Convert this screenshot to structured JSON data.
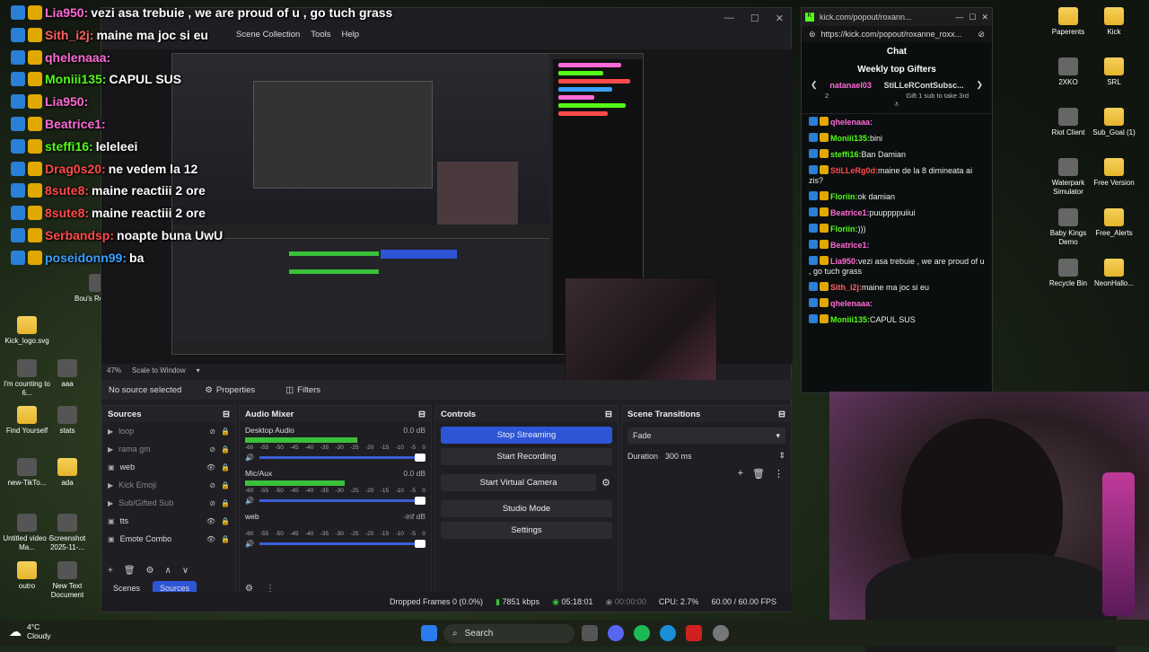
{
  "desktop": {
    "left_icons": [
      {
        "label": "Bou's Revenge"
      },
      {
        "label": "Kick_logo.svg"
      },
      {
        "label": "I'm counting to 6..."
      },
      {
        "label": "aaa"
      },
      {
        "label": "Find Yourself"
      },
      {
        "label": "stats"
      },
      {
        "label": "new-TikTo..."
      },
      {
        "label": "ada"
      },
      {
        "label": "Untitled video - Ma..."
      },
      {
        "label": "Screenshot 2025-11-..."
      },
      {
        "label": "outro"
      },
      {
        "label": "New Text Document"
      }
    ],
    "right_icons": [
      {
        "label": "Paperents"
      },
      {
        "label": "Kick"
      },
      {
        "label": "2XKO"
      },
      {
        "label": "SRL"
      },
      {
        "label": "Riot Client"
      },
      {
        "label": "Sub_Goal (1)"
      },
      {
        "label": "Waterpark Simulator"
      },
      {
        "label": "Free Version"
      },
      {
        "label": "Baby Kings Demo"
      },
      {
        "label": "Free_Alerts"
      },
      {
        "label": "Recycle Bin"
      },
      {
        "label": "NeonHallo..."
      }
    ]
  },
  "overlay_chat": [
    {
      "user": "Lia950:",
      "text": "vezi asa trebuie , we are proud of u , go tuch grass",
      "color": "#ff6bd6"
    },
    {
      "user": "Sith_i2j:",
      "text": "maine ma joc si eu",
      "color": "#ff6060"
    },
    {
      "user": "qhelenaaa:",
      "text": "",
      "color": "#ff6bd6"
    },
    {
      "user": "Moniii135:",
      "text": "CAPUL SUS",
      "color": "#53fc18"
    },
    {
      "user": "Lia950:",
      "text": "",
      "color": "#ff6bd6"
    },
    {
      "user": "Beatrice1:",
      "text": "",
      "color": "#ff6bd6"
    },
    {
      "user": "steffi16:",
      "text": "leleleei",
      "color": "#53fc18"
    },
    {
      "user": "Drag0s20:",
      "text": "ne vedem la 12",
      "color": "#ff4a4a"
    },
    {
      "user": "8sute8:",
      "text": "maine reactiii 2 ore",
      "color": "#ff4a4a"
    },
    {
      "user": "8sute8:",
      "text": "maine reactiii 2 ore",
      "color": "#ff4a4a"
    },
    {
      "user": "Serbandsp:",
      "text": "noapte buna UwU",
      "color": "#ff4a4a"
    },
    {
      "user": "poseidonn99:",
      "text": "ba",
      "color": "#3aa0ff"
    }
  ],
  "obs": {
    "menu": [
      "Scene Collection",
      "Tools",
      "Help"
    ],
    "zoom": "47%",
    "scale_mode": "Scale to Window",
    "no_source": "No source selected",
    "properties_label": "Properties",
    "filters_label": "Filters",
    "sources_title": "Sources",
    "sources": [
      {
        "name": "loop",
        "visible": false
      },
      {
        "name": "rama gm",
        "visible": false
      },
      {
        "name": "web",
        "visible": true
      },
      {
        "name": "Kick Emoji",
        "visible": false
      },
      {
        "name": "Sub/Gifted Sub",
        "visible": false
      },
      {
        "name": "tts",
        "visible": true
      },
      {
        "name": "Emote Combo",
        "visible": true
      }
    ],
    "scenes_tab": "Scenes",
    "sources_tab": "Sources",
    "mixer_title": "Audio Mixer",
    "mixer": [
      {
        "name": "Desktop Audio",
        "db": "0.0 dB",
        "level": 0.62
      },
      {
        "name": "Mic/Aux",
        "db": "0.0 dB",
        "level": 0.55
      },
      {
        "name": "web",
        "db": "-inf dB",
        "level": 0
      }
    ],
    "meter_ticks": [
      "-60",
      "-55",
      "-50",
      "-45",
      "-40",
      "-35",
      "-30",
      "-25",
      "-20",
      "-15",
      "-10",
      "-5",
      "0"
    ],
    "controls_title": "Controls",
    "controls": [
      "Stop Streaming",
      "Start Recording",
      "Start Virtual Camera",
      "Studio Mode",
      "Settings"
    ],
    "transitions_title": "Scene Transitions",
    "transition": "Fade",
    "duration_label": "Duration",
    "duration_value": "300 ms",
    "status": {
      "dropped": "Dropped Frames 0 (0.0%)",
      "kbps": "7851 kbps",
      "live_time": "05:18:01",
      "rec_time": "00:00:00",
      "cpu": "CPU: 2.7%",
      "fps": "60.00 / 60.00 FPS"
    }
  },
  "kick": {
    "tab": "kick.com/popout/roxann...",
    "url": "https://kick.com/popout/roxanne_roxx...",
    "chat_title": "Chat",
    "gifters_title": "Weekly top Gifters",
    "gifters": [
      {
        "name": "natanael03",
        "count": "2"
      },
      {
        "name": "StiLLeRContSubsc...",
        "note": "Gift 1 sub to take 3rd"
      }
    ],
    "messages": [
      {
        "user": "qhelenaaa:",
        "text": "",
        "color": "#ff6bd6"
      },
      {
        "user": "Moniii135:",
        "text": "bini",
        "color": "#53fc18"
      },
      {
        "user": "steffi16:",
        "text": "Ban Damian",
        "color": "#53fc18"
      },
      {
        "user": "StiLLeRg0d:",
        "text": "maine de la 8 dimineata ai zis?",
        "color": "#ff4a4a"
      },
      {
        "user": "Floriin:",
        "text": "ok damian",
        "color": "#53fc18"
      },
      {
        "user": "Beatrice1:",
        "text": "puuppppuiiui",
        "color": "#ff6bd6"
      },
      {
        "user": "Floriin:",
        "text": ")))",
        "color": "#53fc18"
      },
      {
        "user": "Beatrice1:",
        "text": "",
        "color": "#ff6bd6"
      },
      {
        "user": "Lia950:",
        "text": "vezi asa trebuie , we are proud of u , go tuch grass",
        "color": "#ff6bd6"
      },
      {
        "user": "Sith_i2j:",
        "text": "maine ma joc si eu",
        "color": "#ff6060"
      },
      {
        "user": "qhelenaaa:",
        "text": "",
        "color": "#ff6bd6"
      },
      {
        "user": "Moniii135:",
        "text": "CAPUL SUS",
        "color": "#53fc18"
      }
    ]
  },
  "taskbar": {
    "temp": "4°C",
    "condition": "Cloudy",
    "search": "Search"
  }
}
